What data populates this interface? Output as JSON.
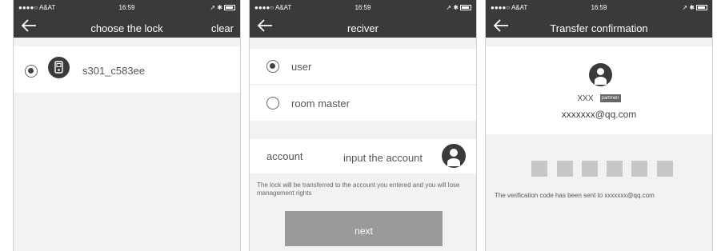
{
  "status_bar": {
    "carrier": "●●●●○ A&AT",
    "time": "16:59",
    "right": "↗ ✱"
  },
  "screen1": {
    "title": "choose the lock",
    "clear_label": "clear",
    "lock_item": {
      "name": "s301_c583ee",
      "selected": true
    }
  },
  "screen2": {
    "title": "reciver",
    "options": [
      {
        "label": "user",
        "selected": true
      },
      {
        "label": "room master",
        "selected": false
      }
    ],
    "account": {
      "label": "account",
      "placeholder": "input the account"
    },
    "notice": "The lock will be transferred to the account you entered and you will lose management rights",
    "next_label": "next"
  },
  "screen3": {
    "title": "Transfer confirmation",
    "user_name": "XXX",
    "department_tag": "partmen",
    "email": "xxxxxxx@qq.com",
    "code_boxes": 6,
    "verification_text": "The verification code has been sent to xxxxxxx@qq.com"
  },
  "colors": {
    "header": "#3a3a3a",
    "background": "#f2f2f2",
    "button": "#9a9a9a",
    "code_box": "#c7c7c7"
  }
}
